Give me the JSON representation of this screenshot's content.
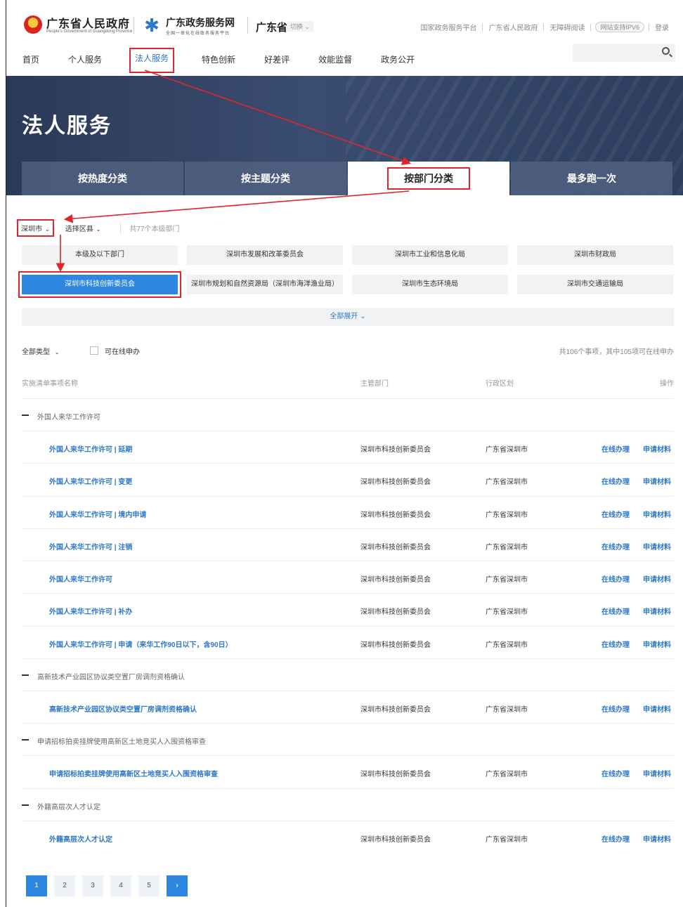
{
  "header": {
    "gov_title": "广东省人民政府",
    "gov_title_en": "People's Government of Guangdong Province",
    "service_title": "广东政务服务网",
    "service_subtitle": "全国一体化在线政务服务平台",
    "province": "广东省",
    "switch_label": "切换",
    "links": [
      "国家政务服务平台",
      "广东省人民政府",
      "无障碍阅读"
    ],
    "ipv6_badge": "网站支持IPV6",
    "login": "登录"
  },
  "nav": {
    "items": [
      "首页",
      "个人服务",
      "法人服务",
      "特色创新",
      "好差评",
      "效能监督",
      "政务公开"
    ],
    "active_index": 2
  },
  "banner": {
    "title": "法人服务",
    "tabs": [
      "按热度分类",
      "按主题分类",
      "按部门分类",
      "最多跑一次"
    ],
    "active_tab": 2
  },
  "filters": {
    "city": "深圳市",
    "district": "选择区县",
    "dept_count": "共77个本级部门"
  },
  "departments": [
    "本级及以下部门",
    "深圳市发展和改革委员会",
    "深圳市工业和信息化局",
    "深圳市财政局",
    "深圳市科技创新委员会",
    "深圳市规划和自然资源局（深圳市海洋渔业局）",
    "深圳市生态环境局",
    "深圳市交通运输局"
  ],
  "active_department_index": 4,
  "expand_label": "全部展开",
  "list_filter": {
    "type": "全部类型",
    "online_checkbox": "可在线申办",
    "summary": "共106个事项，其中105项可在线申办"
  },
  "table": {
    "headers": [
      "实施清单事项名称",
      "主管部门",
      "行政区划",
      "操作"
    ],
    "op_labels": [
      "在线办理",
      "申请材料"
    ],
    "groups": [
      {
        "title": "外国人来华工作许可",
        "rows": [
          {
            "name": "外国人来华工作许可 | 延期",
            "dept": "深圳市科技创新委员会",
            "region": "广东省深圳市"
          },
          {
            "name": "外国人来华工作许可 | 变更",
            "dept": "深圳市科技创新委员会",
            "region": "广东省深圳市"
          },
          {
            "name": "外国人来华工作许可 | 境内申请",
            "dept": "深圳市科技创新委员会",
            "region": "广东省深圳市"
          },
          {
            "name": "外国人来华工作许可 | 注销",
            "dept": "深圳市科技创新委员会",
            "region": "广东省深圳市"
          },
          {
            "name": "外国人来华工作许可",
            "dept": "深圳市科技创新委员会",
            "region": "广东省深圳市"
          },
          {
            "name": "外国人来华工作许可 | 补办",
            "dept": "深圳市科技创新委员会",
            "region": "广东省深圳市"
          },
          {
            "name": "外国人来华工作许可 | 申请（来华工作90日以下，含90日）",
            "dept": "深圳市科技创新委员会",
            "region": "广东省深圳市"
          }
        ]
      },
      {
        "title": "高新技术产业园区协议类空置厂房调剂资格确认",
        "rows": [
          {
            "name": "高新技术产业园区协议类空置厂房调剂资格确认",
            "dept": "深圳市科技创新委员会",
            "region": "广东省深圳市"
          }
        ]
      },
      {
        "title": "申请招标拍卖挂牌使用高新区土地竞买人入围资格审查",
        "rows": [
          {
            "name": "申请招标拍卖挂牌使用高新区土地竞买人入围资格审查",
            "dept": "深圳市科技创新委员会",
            "region": "广东省深圳市"
          }
        ]
      },
      {
        "title": "外籍高层次人才认定",
        "rows": [
          {
            "name": "外籍高层次人才认定",
            "dept": "深圳市科技创新委员会",
            "region": "广东省深圳市"
          }
        ]
      }
    ]
  },
  "pagination": {
    "pages": [
      "1",
      "2",
      "3",
      "4",
      "5"
    ],
    "current": "1",
    "next": "›"
  },
  "colors": {
    "accent": "#2d78c8",
    "active_blue": "#2d86e0",
    "annotation_red": "#e0262b",
    "banner_bg": "#34466a"
  }
}
